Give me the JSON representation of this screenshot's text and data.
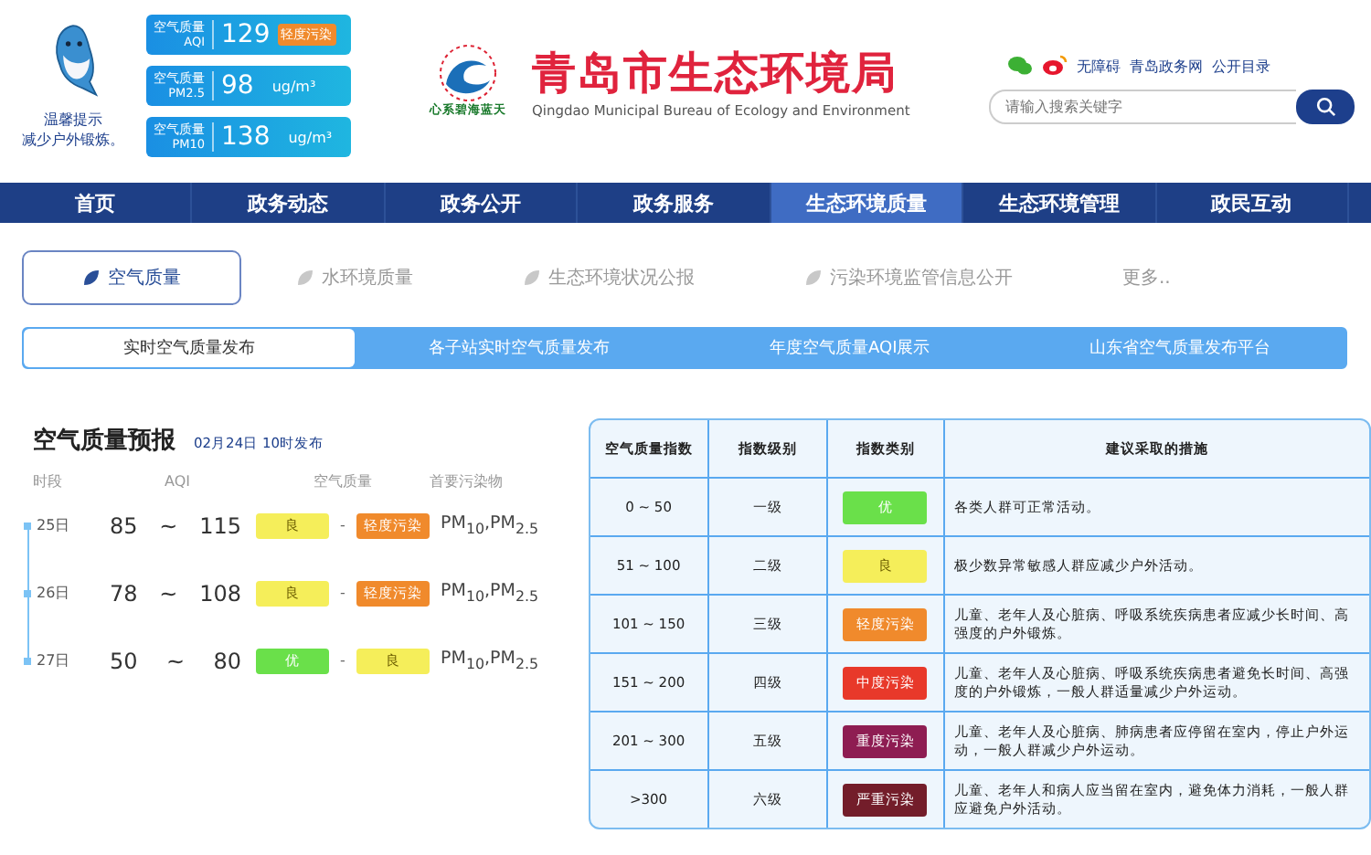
{
  "header": {
    "tip_lines": [
      "温馨提示",
      "减少户外锻炼。"
    ],
    "readings": [
      {
        "label_top": "空气质量",
        "label_bottom": "AQI",
        "value": "129",
        "tag": "轻度污染",
        "color": "#f08a2c"
      },
      {
        "label_top": "空气质量",
        "label_bottom": "PM2.5",
        "value": "98",
        "unit": "ug/m³"
      },
      {
        "label_top": "空气质量",
        "label_bottom": "PM10",
        "value": "138",
        "unit": "ug/m³"
      }
    ],
    "logo_text": "心系碧海蓝天",
    "title": "青岛市生态环境局",
    "subtitle": "Qingdao Municipal Bureau of Ecology and Environment",
    "links": [
      "无障碍",
      "青岛政务网",
      "公开目录"
    ],
    "search": {
      "placeholder": "请输入搜索关键字"
    }
  },
  "nav": [
    {
      "label": "首页",
      "selected": false
    },
    {
      "label": "政务动态",
      "selected": false
    },
    {
      "label": "政务公开",
      "selected": false
    },
    {
      "label": "政务服务",
      "selected": false
    },
    {
      "label": "生态环境质量",
      "selected": true
    },
    {
      "label": "生态环境管理",
      "selected": false
    },
    {
      "label": "政民互动",
      "selected": false
    }
  ],
  "subnav": [
    {
      "label": "空气质量",
      "selected": true,
      "icon": true
    },
    {
      "label": "水环境质量",
      "selected": false,
      "icon": true
    },
    {
      "label": "生态环境状况公报",
      "selected": false,
      "icon": true
    },
    {
      "label": "污染环境监管信息公开",
      "selected": false,
      "icon": true
    },
    {
      "label": "更多..",
      "selected": false,
      "icon": false
    }
  ],
  "tabs": [
    {
      "label": "实时空气质量发布",
      "selected": true
    },
    {
      "label": "各子站实时空气质量发布",
      "selected": false
    },
    {
      "label": "年度空气质量AQI展示",
      "selected": false
    },
    {
      "label": "山东省空气质量发布平台",
      "selected": false
    }
  ],
  "forecast": {
    "title": "空气质量预报",
    "published": "02月24日 10时发布",
    "columns": [
      "时段",
      "AQI",
      "空气质量",
      "首要污染物"
    ],
    "rows": [
      {
        "day": "25日",
        "low": "85",
        "sep": "~",
        "high": "115",
        "from": {
          "label": "良",
          "color": "#f5ee5a"
        },
        "dash": "-",
        "to": {
          "label": "轻度污染",
          "color": "#f08a2c"
        },
        "pollutant": "PM$_{10}$,PM$_{2.5}$"
      },
      {
        "day": "26日",
        "low": "78",
        "sep": "~",
        "high": "108",
        "from": {
          "label": "良",
          "color": "#f5ee5a"
        },
        "dash": "-",
        "to": {
          "label": "轻度污染",
          "color": "#f08a2c"
        },
        "pollutant": "PM$_{10}$,PM$_{2.5}$"
      },
      {
        "day": "27日",
        "low": "50",
        "sep": "~",
        "high": "80",
        "from": {
          "label": "优",
          "color": "#6ae04a"
        },
        "dash": "-",
        "to": {
          "label": "良",
          "color": "#f5ee5a"
        },
        "pollutant": "PM$_{10}$,PM$_{2.5}$"
      }
    ]
  },
  "table": {
    "columns": [
      "空气质量指数",
      "指数级别",
      "指数类别",
      "建议采取的措施"
    ],
    "rows": [
      {
        "range": "0 ~ 50",
        "level": "一级",
        "category": "优",
        "color": "#6ae04a",
        "advice": "各类人群可正常活动。"
      },
      {
        "range": "51 ~ 100",
        "level": "二级",
        "category": "良",
        "color": "#f5ee5a",
        "advice": "极少数异常敏感人群应减少户外活动。"
      },
      {
        "range": "101 ~ 150",
        "level": "三级",
        "category": "轻度污染",
        "color": "#f08a2c",
        "advice": "儿童、老年人及心脏病、呼吸系统疾病患者应减少长时间、高强度的户外锻炼。"
      },
      {
        "range": "151 ~ 200",
        "level": "四级",
        "category": "中度污染",
        "color": "#e8392a",
        "advice": "儿童、老年人及心脏病、呼吸系统疾病患者避免长时间、高强度的户外锻炼，一般人群适量减少户外运动。"
      },
      {
        "range": "201 ~ 300",
        "level": "五级",
        "category": "重度污染",
        "color": "#8e1d52",
        "advice": "儿童、老年人及心脏病、肺病患者应停留在室内，停止户外运动，一般人群减少户外运动。"
      },
      {
        "range": ">300",
        "level": "六级",
        "category": "严重污染",
        "color": "#731d2a",
        "advice": "儿童、老年人和病人应当留在室内，避免体力消耗，一般人群应避免户外活动。"
      }
    ]
  }
}
